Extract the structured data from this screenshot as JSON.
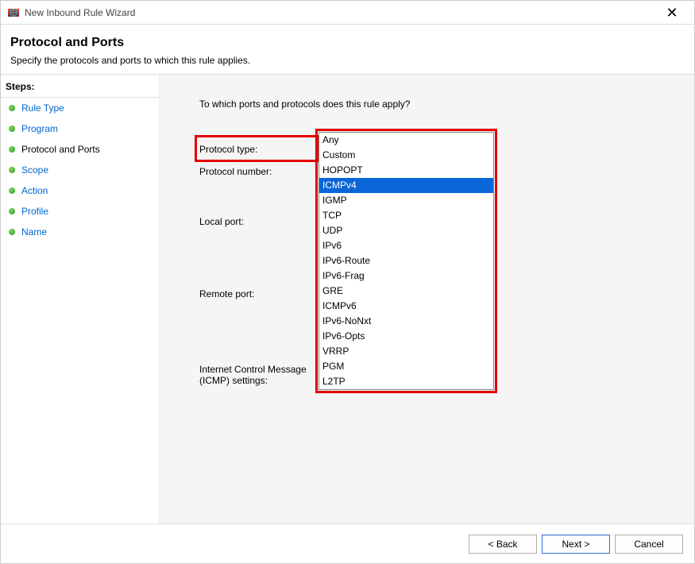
{
  "window": {
    "title": "New Inbound Rule Wizard"
  },
  "header": {
    "title": "Protocol and Ports",
    "subtitle": "Specify the protocols and ports to which this rule applies."
  },
  "steps": {
    "heading": "Steps:",
    "items": [
      {
        "label": "Rule Type",
        "state": "link"
      },
      {
        "label": "Program",
        "state": "link"
      },
      {
        "label": "Protocol and Ports",
        "state": "current"
      },
      {
        "label": "Scope",
        "state": "link"
      },
      {
        "label": "Action",
        "state": "link"
      },
      {
        "label": "Profile",
        "state": "link"
      },
      {
        "label": "Name",
        "state": "link"
      }
    ]
  },
  "main": {
    "prompt": "To which ports and protocols does this rule apply?",
    "labels": {
      "protocol_type": "Protocol type:",
      "protocol_number": "Protocol number:",
      "local_port": "Local port:",
      "remote_port": "Remote port:",
      "icmp_settings": "Internet Control Message Protocol (ICMP) settings:",
      "icmp_settings_l1": "Internet Control Message",
      "icmp_settings_l2": "(ICMP) settings:"
    },
    "protocol_type": {
      "selected": "Any",
      "highlighted": "ICMPv4",
      "options": [
        "Any",
        "Custom",
        "HOPOPT",
        "ICMPv4",
        "IGMP",
        "TCP",
        "UDP",
        "IPv6",
        "IPv6-Route",
        "IPv6-Frag",
        "GRE",
        "ICMPv6",
        "IPv6-NoNxt",
        "IPv6-Opts",
        "VRRP",
        "PGM",
        "L2TP"
      ]
    }
  },
  "footer": {
    "back": "< Back",
    "next": "Next >",
    "cancel": "Cancel"
  }
}
